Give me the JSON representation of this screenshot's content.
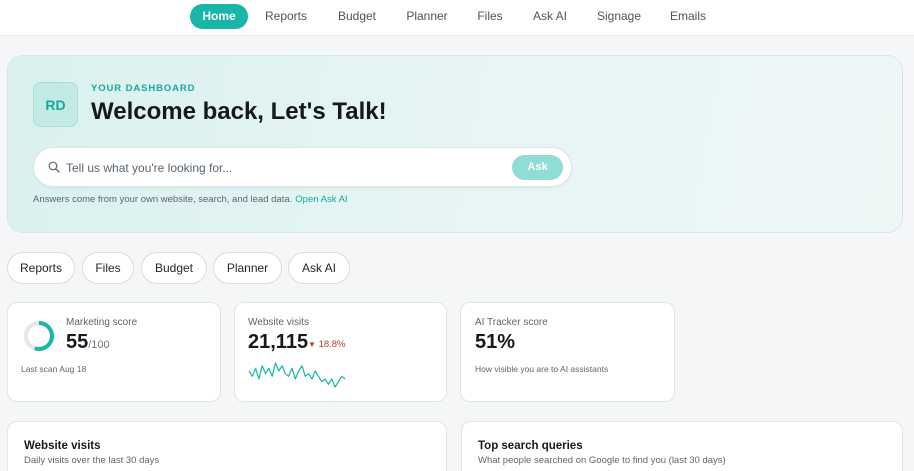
{
  "nav": {
    "items": [
      {
        "label": "Home",
        "active": true
      },
      {
        "label": "Reports",
        "active": false
      },
      {
        "label": "Budget",
        "active": false
      },
      {
        "label": "Planner",
        "active": false
      },
      {
        "label": "Files",
        "active": false
      },
      {
        "label": "Ask AI",
        "active": false
      },
      {
        "label": "Signage",
        "active": false
      },
      {
        "label": "Emails",
        "active": false
      }
    ]
  },
  "hero": {
    "avatar_initials": "RD",
    "eyebrow": "YOUR DASHBOARD",
    "title": "Welcome back, Let's Talk!",
    "search_placeholder": "Tell us what you're looking for...",
    "ask_label": "Ask",
    "note": "Answers come from your own website, search, and lead data.",
    "note_link": "Open Ask AI"
  },
  "quick_links": [
    "Reports",
    "Files",
    "Budget",
    "Planner",
    "Ask AI"
  ],
  "cards": {
    "marketing": {
      "label": "Marketing score",
      "value": "55",
      "unit": "/100",
      "score_fraction": 0.55,
      "sub": "Last scan Aug 18"
    },
    "visits": {
      "label": "Website visits",
      "value": "21,115",
      "delta": "18.8%",
      "delta_arrow": "▼",
      "sparkline": [
        12,
        10,
        13,
        9,
        14,
        11,
        13,
        10,
        15,
        12,
        14,
        11,
        10,
        13,
        9,
        12,
        14,
        10,
        11,
        9,
        12,
        10,
        8,
        9,
        7,
        9,
        6,
        8,
        10,
        9
      ]
    },
    "ai_tracker": {
      "label": "AI Tracker score",
      "value": "51%",
      "sub": "How visible you are to AI assistants"
    }
  },
  "panels": {
    "website_visits": {
      "title": "Website visits",
      "subtitle": "Daily visits over the last 30 days"
    },
    "top_queries": {
      "title": "Top search queries",
      "subtitle": "What people searched on Google to find you (last 30 days)"
    }
  },
  "colors": {
    "accent": "#17b6a8",
    "negative": "#c0392b"
  }
}
